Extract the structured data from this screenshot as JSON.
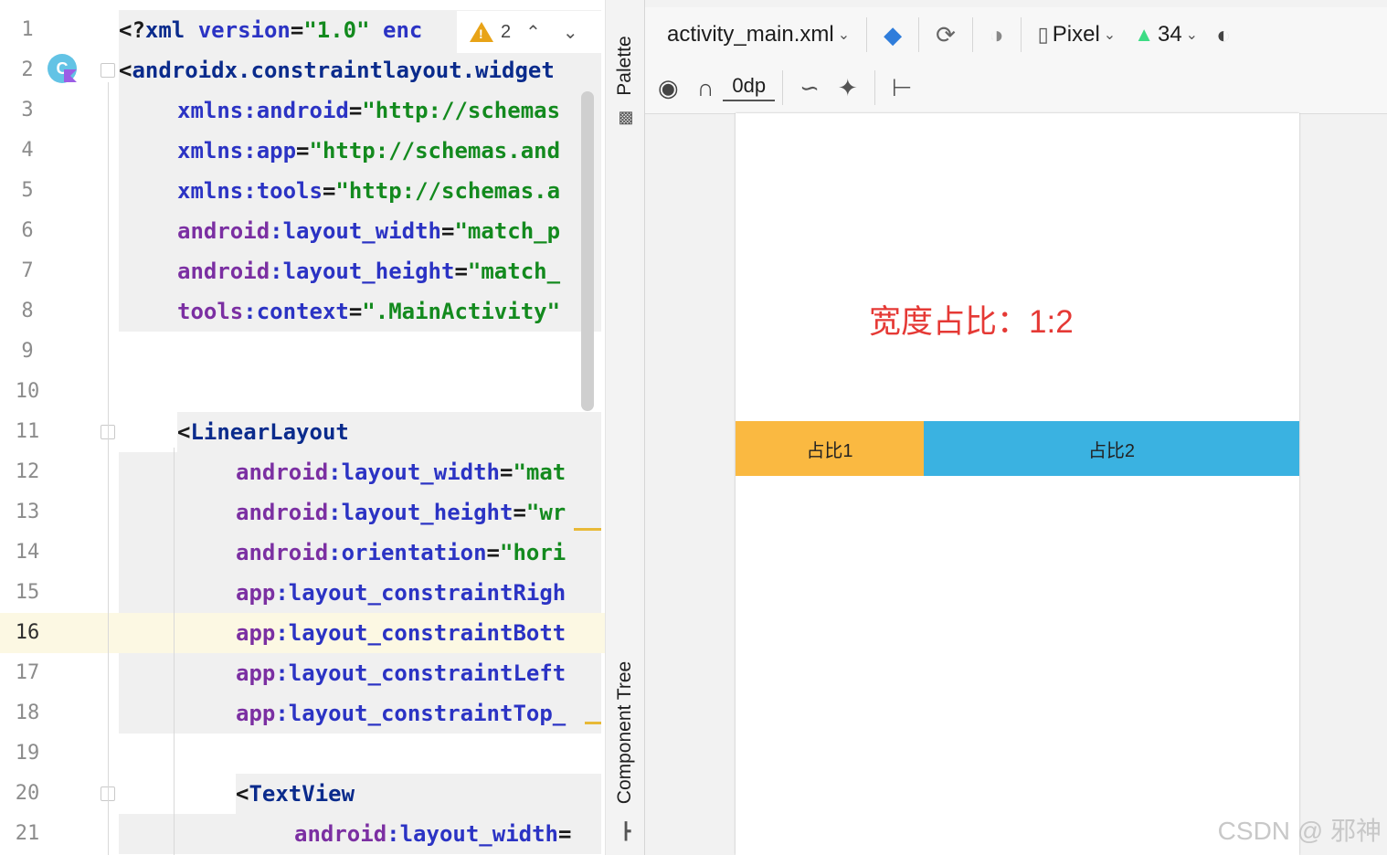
{
  "editor": {
    "warning_count": "2",
    "lines": [
      {
        "n": "1",
        "tokens": [
          [
            "punct",
            "<?"
          ],
          [
            "tag",
            "xml"
          ],
          [
            "punct",
            " "
          ],
          [
            "attr",
            "version"
          ],
          [
            "punct",
            "="
          ],
          [
            "val",
            "\"1.0\""
          ],
          [
            "punct",
            " "
          ],
          [
            "attr",
            "enc"
          ]
        ]
      },
      {
        "n": "2",
        "tokens": [
          [
            "punct",
            "<"
          ],
          [
            "tag",
            "androidx.constraintlayout.widget"
          ]
        ]
      },
      {
        "n": "3",
        "tokens": [
          [
            "attr",
            "xmlns:android"
          ],
          [
            "punct",
            "="
          ],
          [
            "val",
            "\"http://schemas"
          ]
        ]
      },
      {
        "n": "4",
        "tokens": [
          [
            "attr",
            "xmlns:app"
          ],
          [
            "punct",
            "="
          ],
          [
            "val",
            "\"http://schemas.and"
          ]
        ]
      },
      {
        "n": "5",
        "tokens": [
          [
            "attr",
            "xmlns:tools"
          ],
          [
            "punct",
            "="
          ],
          [
            "val",
            "\"http://schemas.a"
          ]
        ]
      },
      {
        "n": "6",
        "tokens": [
          [
            "ns",
            "android"
          ],
          [
            "attr",
            ":layout_width"
          ],
          [
            "punct",
            "="
          ],
          [
            "val",
            "\"match_p"
          ]
        ]
      },
      {
        "n": "7",
        "tokens": [
          [
            "ns",
            "android"
          ],
          [
            "attr",
            ":layout_height"
          ],
          [
            "punct",
            "="
          ],
          [
            "val",
            "\"match_"
          ]
        ]
      },
      {
        "n": "8",
        "tokens": [
          [
            "ns",
            "tools"
          ],
          [
            "attr",
            ":context"
          ],
          [
            "punct",
            "="
          ],
          [
            "val",
            "\".MainActivity\""
          ]
        ]
      },
      {
        "n": "9",
        "tokens": []
      },
      {
        "n": "10",
        "tokens": []
      },
      {
        "n": "11",
        "tokens": [
          [
            "punct",
            "<"
          ],
          [
            "tag",
            "LinearLayout"
          ]
        ]
      },
      {
        "n": "12",
        "tokens": [
          [
            "ns",
            "android"
          ],
          [
            "attr",
            ":layout_width"
          ],
          [
            "punct",
            "="
          ],
          [
            "val",
            "\"mat"
          ]
        ]
      },
      {
        "n": "13",
        "tokens": [
          [
            "ns",
            "android"
          ],
          [
            "attr",
            ":layout_height"
          ],
          [
            "punct",
            "="
          ],
          [
            "val",
            "\"wr"
          ]
        ]
      },
      {
        "n": "14",
        "tokens": [
          [
            "ns",
            "android"
          ],
          [
            "attr",
            ":orientation"
          ],
          [
            "punct",
            "="
          ],
          [
            "val",
            "\"hori"
          ]
        ]
      },
      {
        "n": "15",
        "tokens": [
          [
            "ns",
            "app"
          ],
          [
            "attr",
            ":layout_constraintRigh"
          ]
        ]
      },
      {
        "n": "16",
        "tokens": [
          [
            "ns",
            "app"
          ],
          [
            "attr",
            ":layout_constraintBott"
          ]
        ]
      },
      {
        "n": "17",
        "tokens": [
          [
            "ns",
            "app"
          ],
          [
            "attr",
            ":layout_constraintLeft"
          ]
        ]
      },
      {
        "n": "18",
        "tokens": [
          [
            "ns",
            "app"
          ],
          [
            "attr",
            ":layout_constraintTop_"
          ]
        ]
      },
      {
        "n": "19",
        "tokens": []
      },
      {
        "n": "20",
        "tokens": [
          [
            "punct",
            "<"
          ],
          [
            "tag",
            "TextView"
          ]
        ]
      },
      {
        "n": "21",
        "tokens": [
          [
            "ns",
            "android"
          ],
          [
            "attr",
            ":layout_width"
          ],
          [
            "punct",
            "="
          ]
        ]
      }
    ]
  },
  "side_panel": {
    "palette_label": "Palette",
    "component_tree_label": "Component Tree"
  },
  "design_toolbar": {
    "file_name": "activity_main.xml",
    "device": "Pixel",
    "api_level": "34",
    "margin_value": "0dp"
  },
  "preview": {
    "ratio_text": "宽度占比：1:2",
    "segment1_label": "占比1",
    "segment2_label": "占比2",
    "weights": [
      1,
      2
    ],
    "segment1_color": "#fab941",
    "segment2_color": "#3ab2e1",
    "ratio_text_color": "#e53935"
  },
  "watermark": "CSDN @ 邪神"
}
